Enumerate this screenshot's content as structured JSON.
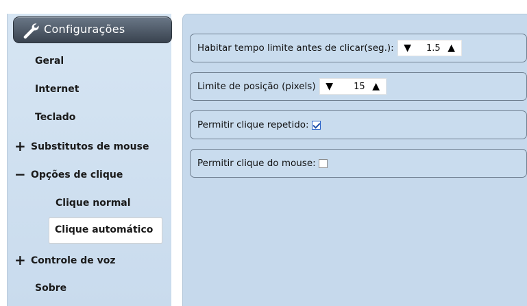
{
  "sidebar": {
    "title": "Configurações",
    "items": [
      {
        "label": "Geral",
        "expander": ""
      },
      {
        "label": "Internet",
        "expander": ""
      },
      {
        "label": "Teclado",
        "expander": ""
      },
      {
        "label": "Substitutos de mouse",
        "expander": "+"
      },
      {
        "label": "Opções de clique",
        "expander": "−"
      },
      {
        "label": "Clique normal",
        "expander": ""
      },
      {
        "label": "Clique automático",
        "expander": "",
        "selected": true
      },
      {
        "label": "Controle de voz",
        "expander": "+"
      },
      {
        "label": "Sobre",
        "expander": ""
      }
    ]
  },
  "settings": {
    "timeout": {
      "label": "Habitar tempo limite antes de clicar(seg.):",
      "decrement": "▼",
      "value": "1.5",
      "increment": "▲"
    },
    "position": {
      "label": "Limite de posição (pixels)",
      "decrement": "▼",
      "value": "15",
      "increment": "▲"
    },
    "repeat": {
      "label": "Permitir clique repetido:",
      "checked": true
    },
    "mouse": {
      "label": "Permitir clique do mouse:",
      "checked": false
    }
  },
  "icons": {
    "header": "wrench-icon"
  },
  "colors": {
    "header_bg": "#39434f",
    "panel_bg": "#c6d9ec",
    "sidebar_bg": "#d0e0f0"
  }
}
